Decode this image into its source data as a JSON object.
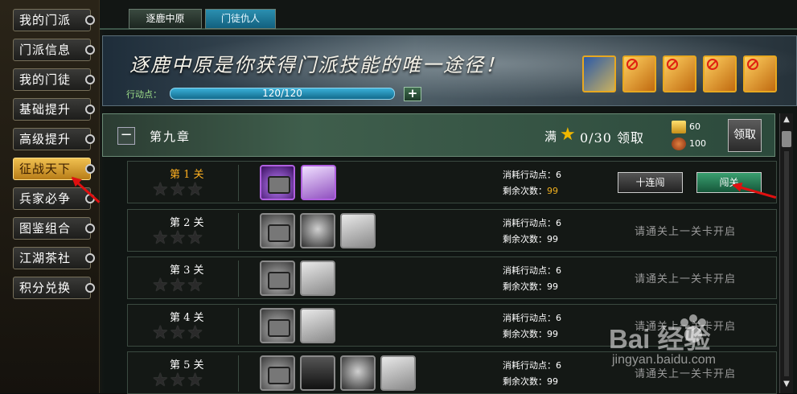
{
  "sidebar": {
    "items": [
      {
        "label": "我的门派"
      },
      {
        "label": "门派信息"
      },
      {
        "label": "我的门徒"
      },
      {
        "label": "基础提升"
      },
      {
        "label": "高级提升"
      },
      {
        "label": "征战天下",
        "active": true
      },
      {
        "label": "兵家必争"
      },
      {
        "label": "图鉴组合"
      },
      {
        "label": "江湖茶社"
      },
      {
        "label": "积分兑换"
      }
    ]
  },
  "tabs": [
    {
      "label": "逐鹿中原",
      "active": true
    },
    {
      "label": "门徒仇人",
      "active": false
    }
  ],
  "banner": {
    "slogan": "逐鹿中原是你获得门派技能的唯一途径！",
    "action_points_label": "行动点：",
    "action_points_value": "120/120",
    "action_points_fraction": 1.0,
    "plus_label": "+",
    "bonus_items": [
      {
        "icon": "book-icon",
        "locked": false
      },
      {
        "icon": "scroll-icon",
        "locked": true
      },
      {
        "icon": "scroll-icon",
        "locked": true
      },
      {
        "icon": "scroll-icon",
        "locked": true
      },
      {
        "icon": "scroll-icon",
        "locked": true
      }
    ]
  },
  "chapter": {
    "collapse_label": "−",
    "title": "第九章",
    "full_label": "满",
    "star_icon": "★",
    "progress": "0/30 领取",
    "gold": "60",
    "bag": "100",
    "claim_label": "领取"
  },
  "levels": [
    {
      "name": "第 1 关",
      "stars": "★★★",
      "items": [
        "chest-icon",
        "book-icon"
      ],
      "tier": "purple",
      "cost": "消耗行动点：6",
      "left_label": "剩余次数：",
      "left_value": "99",
      "current": true,
      "ten_label": "十连闯",
      "go_label": "闯关"
    },
    {
      "name": "第 2 关",
      "stars": "★★★",
      "items": [
        "chest-icon",
        "general-icon",
        "book-icon"
      ],
      "cost": "消耗行动点：6",
      "left_label": "剩余次数：",
      "left_value": "99",
      "locked_text": "请通关上一关卡开启"
    },
    {
      "name": "第 3 关",
      "stars": "★★★",
      "items": [
        "chest-icon",
        "book-icon"
      ],
      "cost": "消耗行动点：6",
      "left_label": "剩余次数：",
      "left_value": "99",
      "locked_text": "请通关上一关卡开启"
    },
    {
      "name": "第 4 关",
      "stars": "★★★",
      "items": [
        "chest-icon",
        "book-icon"
      ],
      "cost": "消耗行动点：6",
      "left_label": "剩余次数：",
      "left_value": "99",
      "locked_text": "请通关上一关卡开启"
    },
    {
      "name": "第 5 关",
      "stars": "★★★",
      "items": [
        "chest-icon",
        "sword-icon",
        "general-icon",
        "book-icon"
      ],
      "cost": "消耗行动点：6",
      "left_label": "剩余次数：",
      "left_value": "99",
      "locked_text": "请通关上一关卡开启"
    }
  ],
  "watermark": {
    "brand": "Bai  经验",
    "url": "jingyan.baidu.com"
  },
  "colors": {
    "accent_gold": "#f0b800",
    "go_button": "#3aa070",
    "arrow": "#e01010"
  }
}
